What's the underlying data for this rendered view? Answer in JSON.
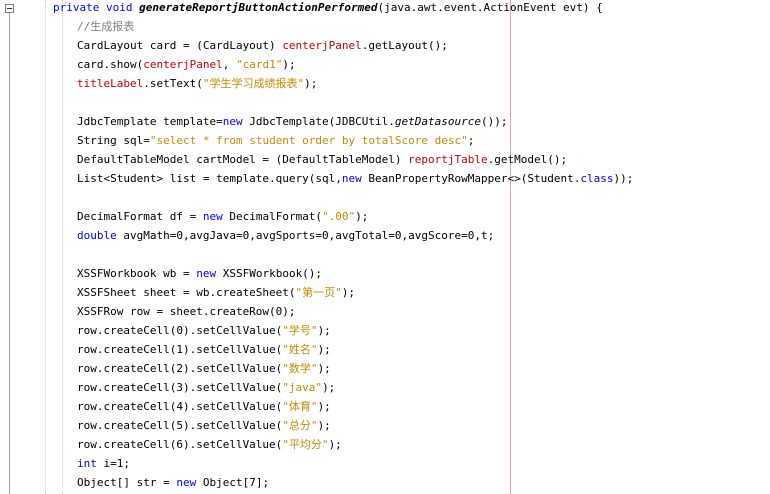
{
  "editor": {
    "lines": [
      {
        "indent": 1,
        "tokens": [
          {
            "t": "private",
            "c": "kw"
          },
          {
            "t": " "
          },
          {
            "t": "void",
            "c": "kw"
          },
          {
            "t": " "
          },
          {
            "t": "generateReportjButtonActionPerformed",
            "c": "md"
          },
          {
            "t": "(java.awt.event.ActionEvent evt) {"
          }
        ]
      },
      {
        "indent": 2,
        "tokens": [
          {
            "t": "//生成报表",
            "c": "cm"
          }
        ]
      },
      {
        "indent": 2,
        "tokens": [
          {
            "t": "CardLayout card = (CardLayout) "
          },
          {
            "t": "centerjPanel",
            "c": "fd"
          },
          {
            "t": ".getLayout();"
          }
        ]
      },
      {
        "indent": 2,
        "tokens": [
          {
            "t": "card.show("
          },
          {
            "t": "centerjPanel",
            "c": "fd"
          },
          {
            "t": ", "
          },
          {
            "t": "\"card1\"",
            "c": "st"
          },
          {
            "t": ");"
          }
        ]
      },
      {
        "indent": 2,
        "tokens": [
          {
            "t": "titleLabel",
            "c": "fd"
          },
          {
            "t": ".setText("
          },
          {
            "t": "\"学生学习成绩报表\"",
            "c": "st"
          },
          {
            "t": ");"
          }
        ]
      },
      {
        "indent": 2,
        "tokens": []
      },
      {
        "indent": 2,
        "tokens": [
          {
            "t": "JdbcTemplate template="
          },
          {
            "t": "new",
            "c": "kw"
          },
          {
            "t": " JdbcTemplate(JDBCUtil."
          },
          {
            "t": "getDatasource",
            "c": "it"
          },
          {
            "t": "());"
          }
        ]
      },
      {
        "indent": 2,
        "tokens": [
          {
            "t": "String sql="
          },
          {
            "t": "\"select * from student order by totalScore desc\"",
            "c": "st"
          },
          {
            "t": ";"
          }
        ]
      },
      {
        "indent": 2,
        "tokens": [
          {
            "t": "DefaultTableModel cartModel = (DefaultTableModel) "
          },
          {
            "t": "reportjTable",
            "c": "fd"
          },
          {
            "t": ".getModel();"
          }
        ]
      },
      {
        "indent": 2,
        "tokens": [
          {
            "t": "List<Student> list = template.query(sql,"
          },
          {
            "t": "new",
            "c": "kw"
          },
          {
            "t": " BeanPropertyRowMapper<>(Student."
          },
          {
            "t": "class",
            "c": "kw"
          },
          {
            "t": "));"
          }
        ]
      },
      {
        "indent": 2,
        "tokens": []
      },
      {
        "indent": 2,
        "tokens": [
          {
            "t": "DecimalFormat df = "
          },
          {
            "t": "new",
            "c": "kw"
          },
          {
            "t": " DecimalFormat("
          },
          {
            "t": "\".00\"",
            "c": "st"
          },
          {
            "t": ");"
          }
        ]
      },
      {
        "indent": 2,
        "tokens": [
          {
            "t": "double",
            "c": "kw"
          },
          {
            "t": " avgMath=0,avgJava=0,avgSports=0,avgTotal=0,avgScore=0,t;"
          }
        ]
      },
      {
        "indent": 2,
        "tokens": []
      },
      {
        "indent": 2,
        "tokens": [
          {
            "t": "XSSFWorkbook wb = "
          },
          {
            "t": "new",
            "c": "kw"
          },
          {
            "t": " XSSFWorkbook();"
          }
        ]
      },
      {
        "indent": 2,
        "tokens": [
          {
            "t": "XSSFSheet sheet = wb.createSheet("
          },
          {
            "t": "\"第一页\"",
            "c": "st"
          },
          {
            "t": ");"
          }
        ]
      },
      {
        "indent": 2,
        "tokens": [
          {
            "t": "XSSFRow row = sheet.createRow(0);"
          }
        ]
      },
      {
        "indent": 2,
        "tokens": [
          {
            "t": "row.createCell(0).setCellValue("
          },
          {
            "t": "\"学号\"",
            "c": "st"
          },
          {
            "t": ");"
          }
        ]
      },
      {
        "indent": 2,
        "tokens": [
          {
            "t": "row.createCell(1).setCellValue("
          },
          {
            "t": "\"姓名\"",
            "c": "st"
          },
          {
            "t": ");"
          }
        ]
      },
      {
        "indent": 2,
        "tokens": [
          {
            "t": "row.createCell(2).setCellValue("
          },
          {
            "t": "\"数学\"",
            "c": "st"
          },
          {
            "t": ");"
          }
        ]
      },
      {
        "indent": 2,
        "tokens": [
          {
            "t": "row.createCell(3).setCellValue("
          },
          {
            "t": "\"java\"",
            "c": "st"
          },
          {
            "t": ");"
          }
        ]
      },
      {
        "indent": 2,
        "tokens": [
          {
            "t": "row.createCell(4).setCellValue("
          },
          {
            "t": "\"体育\"",
            "c": "st"
          },
          {
            "t": ");"
          }
        ]
      },
      {
        "indent": 2,
        "tokens": [
          {
            "t": "row.createCell(5).setCellValue("
          },
          {
            "t": "\"总分\"",
            "c": "st"
          },
          {
            "t": ");"
          }
        ]
      },
      {
        "indent": 2,
        "tokens": [
          {
            "t": "row.createCell(6).setCellValue("
          },
          {
            "t": "\"平均分\"",
            "c": "st"
          },
          {
            "t": ");"
          }
        ]
      },
      {
        "indent": 2,
        "tokens": [
          {
            "t": "int",
            "c": "kw"
          },
          {
            "t": " i=1;"
          }
        ]
      },
      {
        "indent": 2,
        "tokens": [
          {
            "t": "Object[] str = "
          },
          {
            "t": "new",
            "c": "kw"
          },
          {
            "t": " Object[7];"
          }
        ]
      }
    ]
  }
}
